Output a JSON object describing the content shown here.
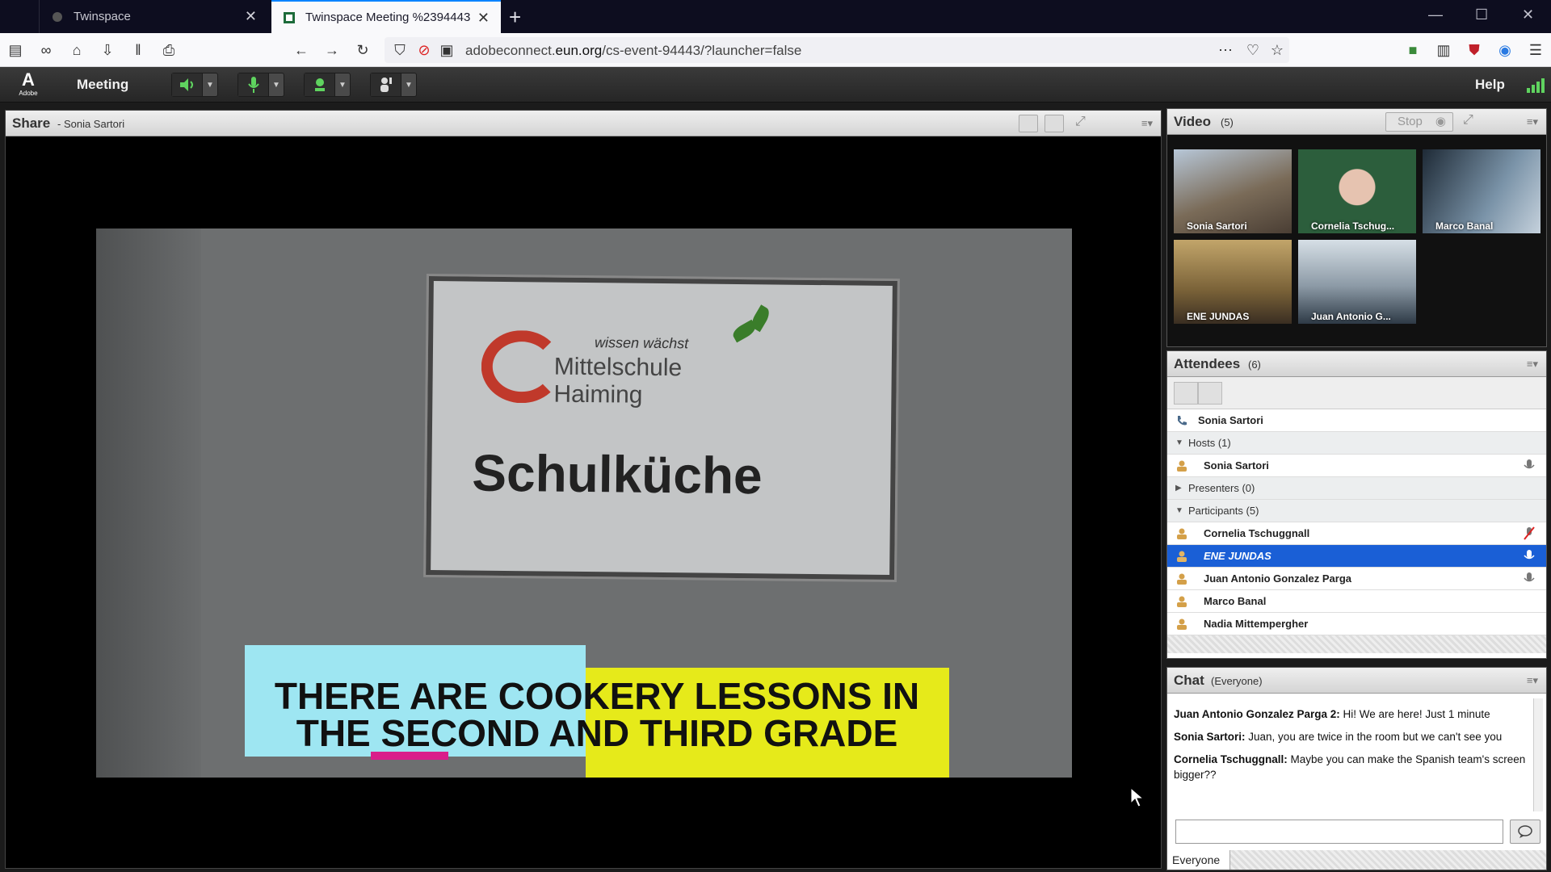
{
  "browser": {
    "tabs": [
      {
        "label": "Twinspace",
        "active": false
      },
      {
        "label": "Twinspace Meeting %2394443",
        "active": true
      }
    ],
    "new_tab": "+",
    "url_prefix": "adobeconnect.",
    "url_domain": "eun.org",
    "url_path": "/cs-event-94443/?launcher=false"
  },
  "app": {
    "logo_text": "Adobe",
    "menu_meeting": "Meeting",
    "menu_help": "Help"
  },
  "share": {
    "title": "Share",
    "subtitle": "- Sonia Sartori",
    "content": {
      "sign_tagline": "wissen wächst",
      "sign_line1": "Mittelschule",
      "sign_line2": "Haiming",
      "sign_main": "Schulküche",
      "caption": "THERE ARE COOKERY LESSONS IN THE SECOND AND THIRD GRADE"
    }
  },
  "video": {
    "title": "Video",
    "count": "(5)",
    "stop_label": "Stop",
    "feeds": [
      {
        "name": "Sonia Sartori"
      },
      {
        "name": "Cornelia Tschug..."
      },
      {
        "name": "Marco Banal"
      },
      {
        "name": "ENE JUNDAS"
      },
      {
        "name": "Juan Antonio G..."
      }
    ]
  },
  "attendees": {
    "title": "Attendees",
    "count": "(6)",
    "me": "Sonia Sartori",
    "groups": {
      "hosts": "Hosts (1)",
      "presenters": "Presenters (0)",
      "participants": "Participants (5)"
    },
    "hosts": [
      "Sonia Sartori"
    ],
    "participants": [
      "Cornelia Tschuggnall",
      "ENE JUNDAS",
      "Juan Antonio Gonzalez Parga",
      "Marco Banal",
      "Nadia Mittempergher"
    ]
  },
  "chat": {
    "title": "Chat",
    "scope": "(Everyone)",
    "messages": [
      {
        "sender": "Juan Antonio Gonzalez Parga 2:",
        "text": "Hi! We are here! Just 1 minute"
      },
      {
        "sender": "Sonia Sartori:",
        "text": "Juan, you are twice in the room but we can't see you"
      },
      {
        "sender": "Cornelia Tschuggnall:",
        "text": "Maybe you can make the Spanish team's screen bigger??"
      }
    ],
    "input_value": "",
    "tab_label": "Everyone"
  },
  "colors": {
    "selection": "#1a5fd6",
    "signal": "#5fd35f",
    "caption_cyan": "#9ee6f2",
    "caption_yellow": "#e6ea1a"
  }
}
